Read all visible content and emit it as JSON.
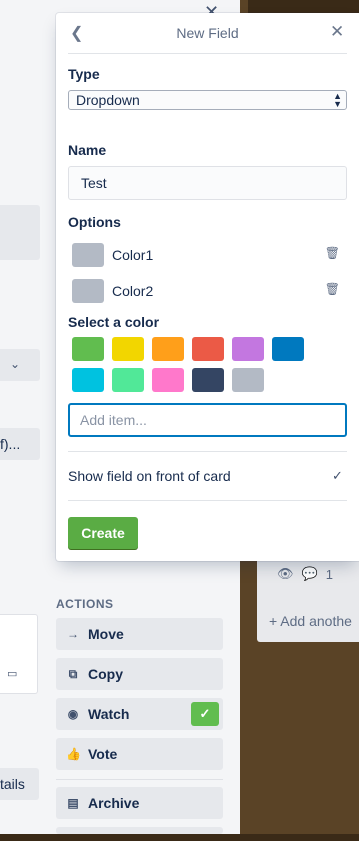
{
  "popover": {
    "title": "New Field",
    "type_label": "Type",
    "type_value": "Dropdown",
    "name_label": "Name",
    "name_value": "Test",
    "options_label": "Options",
    "options": [
      {
        "name": "Color1",
        "color": "#b3bac5"
      },
      {
        "name": "Color2",
        "color": "#b3bac5"
      }
    ],
    "select_color_label": "Select a color",
    "colors": [
      "#61bd4f",
      "#f2d600",
      "#ff9f1a",
      "#eb5a46",
      "#c377e0",
      "#0079bf",
      "#00c2e0",
      "#51e898",
      "#ff78cb",
      "#344563",
      "#b3bac5"
    ],
    "add_item_placeholder": "Add item...",
    "show_on_front_label": "Show field on front of card",
    "create_label": "Create"
  },
  "window": {
    "left_truncated_1": "f)...",
    "left_truncated_2": "tails"
  },
  "actions": {
    "title": "ACTIONS",
    "items": [
      {
        "label": "Move",
        "icon": "arrow-right-icon"
      },
      {
        "label": "Copy",
        "icon": "copy-icon"
      },
      {
        "label": "Watch",
        "icon": "eye-icon",
        "checked": true
      },
      {
        "label": "Vote",
        "icon": "thumbs-up-icon"
      },
      {
        "label": "Archive",
        "icon": "archive-icon"
      }
    ]
  },
  "board": {
    "comment_count": "1",
    "add_another": "+ Add anothe"
  }
}
